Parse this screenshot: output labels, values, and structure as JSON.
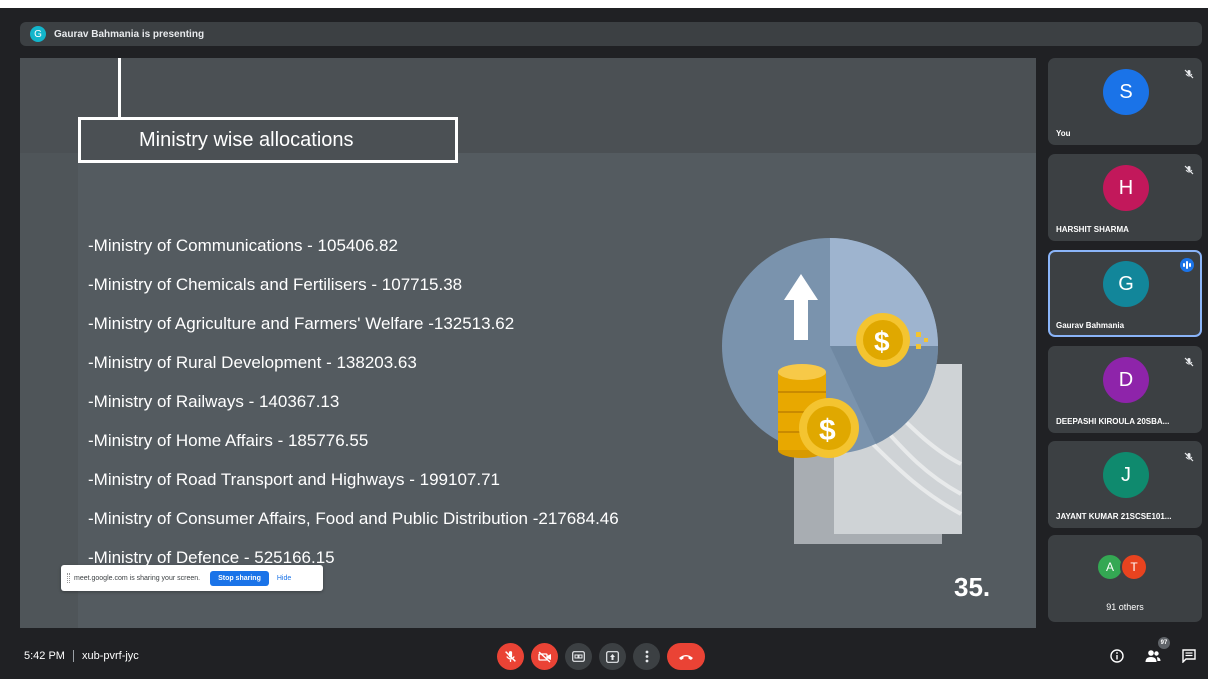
{
  "presenting_bar": {
    "avatar_initial": "G",
    "text": "Gaurav Bahmania is presenting"
  },
  "slide": {
    "title": "Ministry wise allocations",
    "items": [
      "-Ministry of Communications  - 105406.82",
      "-Ministry of Chemicals and Fertilisers -  107715.38",
      "-Ministry of Agriculture and Farmers' Welfare  -132513.62",
      "-Ministry of Rural Development -  138203.63",
      "-Ministry of Railways -  140367.13",
      "-Ministry of Home Affairs -  185776.55",
      "-Ministry of Road Transport and Highways -  199107.71",
      "-Ministry of Consumer Affairs, Food and Public Distribution -217684.46",
      "-Ministry of Defence -  525166.15"
    ],
    "slide_number": "35."
  },
  "share_toast": {
    "message": "meet.google.com is sharing your screen.",
    "stop_label": "Stop sharing",
    "hide_label": "Hide"
  },
  "participants": [
    {
      "initial": "S",
      "name": "You",
      "color": "#1a73e8",
      "muted": true
    },
    {
      "initial": "H",
      "name": "HARSHIT SHARMA",
      "color": "#c2185b",
      "muted": true
    },
    {
      "initial": "G",
      "name": "Gaurav Bahmania",
      "color": "#12869a",
      "muted": false,
      "speaking": true
    },
    {
      "initial": "D",
      "name": "DEEPASHI KIROULA 20SBA...",
      "color": "#8e24aa",
      "muted": true
    },
    {
      "initial": "J",
      "name": "JAYANT KUMAR 21SCSE101...",
      "color": "#0f8a6e",
      "muted": true
    }
  ],
  "others": {
    "avatars": [
      {
        "initial": "A",
        "color": "#34a853"
      },
      {
        "initial": "T",
        "color": "#e8431f"
      }
    ],
    "label": "91 others"
  },
  "bottom_bar": {
    "time": "5:42 PM",
    "meeting_code": "xub-pvrf-jyc",
    "people_count": "97"
  },
  "colors": {
    "end_call": "#ea4335",
    "accent": "#1a73e8",
    "tile_bg": "#3c4043",
    "background": "#202124"
  }
}
